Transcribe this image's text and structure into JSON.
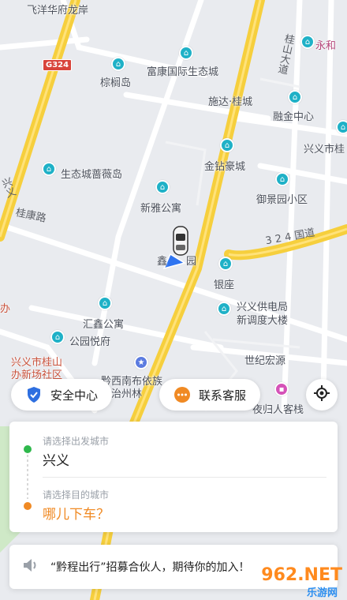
{
  "map": {
    "labels": {
      "feiyang": "飞洋华府龙岸",
      "zonglu": "棕榈岛",
      "fukang": "富康国际生态城",
      "shida": "施达·桂城",
      "rongjin": "融金中心",
      "xingyi_city": "兴义市桂",
      "jinzuan": "金钻豪城",
      "shengtai": "生态城蔷薇岛",
      "yujing": "御景园小区",
      "xinya": "新雅公寓",
      "yinzuo": "银座",
      "xin_yuan": "鑫",
      "yuan_char": "园",
      "gongdian": "兴义供电局",
      "xintiao": "新调度大楼",
      "huixin": "汇鑫公寓",
      "gongyuan": "公园悦府",
      "shiji": "世纪宏源",
      "guishan": "兴义市桂山",
      "banshi": "办新场社区",
      "qianxinan": "黔西南布依族",
      "zizhi": "自治州林",
      "guiren": "夜归人客栈",
      "yonghe": "永和",
      "banshi2": "办"
    },
    "roads": {
      "guikang": "桂康路",
      "guishan_ave": "桂山大道",
      "guodao": "3 2 4 国道",
      "xingyi_road": "兴义",
      "shield": "G324"
    },
    "colors": {
      "main_road": "#f6cf3d",
      "road": "#ffffff",
      "bg": "#e9ebef",
      "green": "#c8ecc0"
    }
  },
  "actions": {
    "safety": {
      "label": "安全中心",
      "icon": "shield-check-icon",
      "color": "#2e6fe0"
    },
    "service": {
      "label": "联系客服",
      "icon": "chat-bubble-icon",
      "color": "#f08a24"
    },
    "locate": {
      "icon": "locate-icon"
    }
  },
  "trip": {
    "origin_hint": "请选择出发城市",
    "origin_value": "兴义",
    "origin_color": "#2fb84c",
    "dest_hint": "请选择目的城市",
    "dest_value": "哪儿下车？",
    "dest_color": "#f08a24"
  },
  "notice": {
    "icon": "speaker-icon",
    "text": "“黔程出行”招募合伙人，期待你的加入！"
  },
  "watermark": {
    "main": "962.NET",
    "sub": "乐游网"
  }
}
